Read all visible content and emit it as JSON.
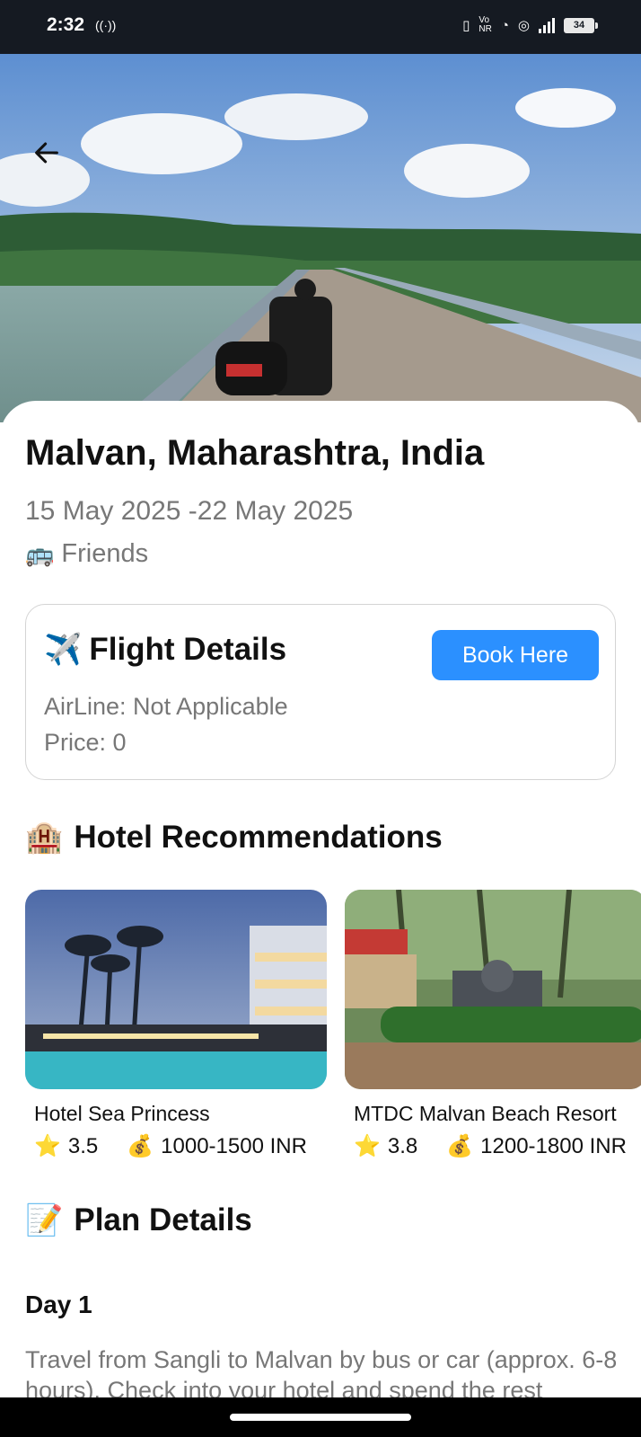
{
  "status_bar": {
    "time": "2:32",
    "cast_icon": "cast-icon",
    "battery_level": "34",
    "icons": [
      "vibrate-icon",
      "volte-icon",
      "wifi-icon",
      "hotspot-icon",
      "signal-icon",
      "battery-icon"
    ]
  },
  "hero": {
    "back_icon": "arrow-left-icon"
  },
  "trip": {
    "title": "Malvan, Maharashtra, India",
    "dates": "15 May 2025 -22 May 2025",
    "traveler_icon": "🚌",
    "traveler": "Friends"
  },
  "flight": {
    "icon": "✈️",
    "title": "Flight Details",
    "book_label": "Book Here",
    "airline": "AirLine: Not Applicable",
    "price": "Price: 0",
    "button_color": "#2b90ff"
  },
  "hotels": {
    "icon": "🏨",
    "title": "Hotel Recommendations",
    "items": [
      {
        "name": "Hotel Sea Princess",
        "rating_icon": "⭐",
        "rating": "3.5",
        "price_icon": "💰",
        "price": "1000-1500 INR"
      },
      {
        "name": "MTDC Malvan Beach Resort",
        "rating_icon": "⭐",
        "rating": "3.8",
        "price_icon": "💰",
        "price": "1200-1800 INR"
      }
    ]
  },
  "plan": {
    "icon": "📝",
    "title": "Plan Details",
    "days": [
      {
        "label": "Day 1",
        "text": "Travel from Sangli to Malvan by bus or car (approx. 6-8 hours). Check into your hotel and spend the rest"
      }
    ]
  }
}
